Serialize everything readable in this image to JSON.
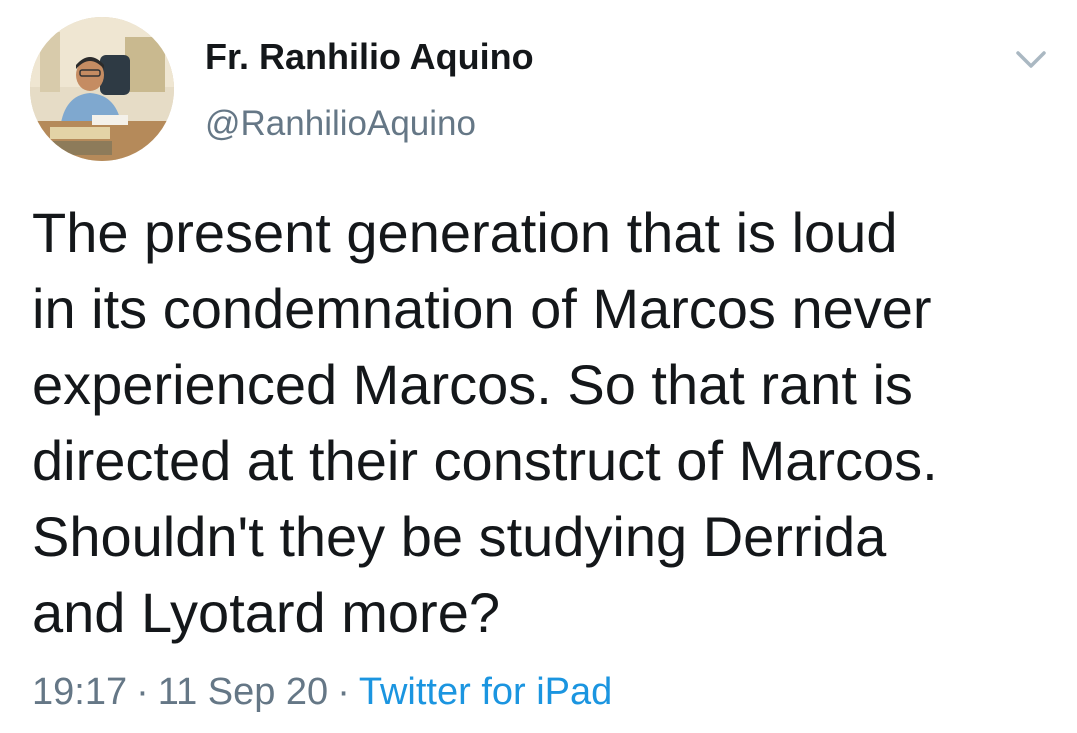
{
  "author": {
    "display_name": "Fr. Ranhilio Aquino",
    "handle": "@RanhilioAquino"
  },
  "tweet": {
    "text": "The present generation that is loud\nin its condemnation of Marcos never\nexperienced Marcos. So that rant is\ndirected at their construct of Marcos.\nShouldn't they be studying Derrida\nand Lyotard more?",
    "time": "19:17",
    "date": "11 Sep 20",
    "separator": "·",
    "source": "Twitter for iPad"
  },
  "icons": {
    "menu": "chevron-down-icon"
  },
  "colors": {
    "text": "#14171a",
    "secondary": "#657786",
    "link": "#1b95e0",
    "background": "#ffffff"
  }
}
